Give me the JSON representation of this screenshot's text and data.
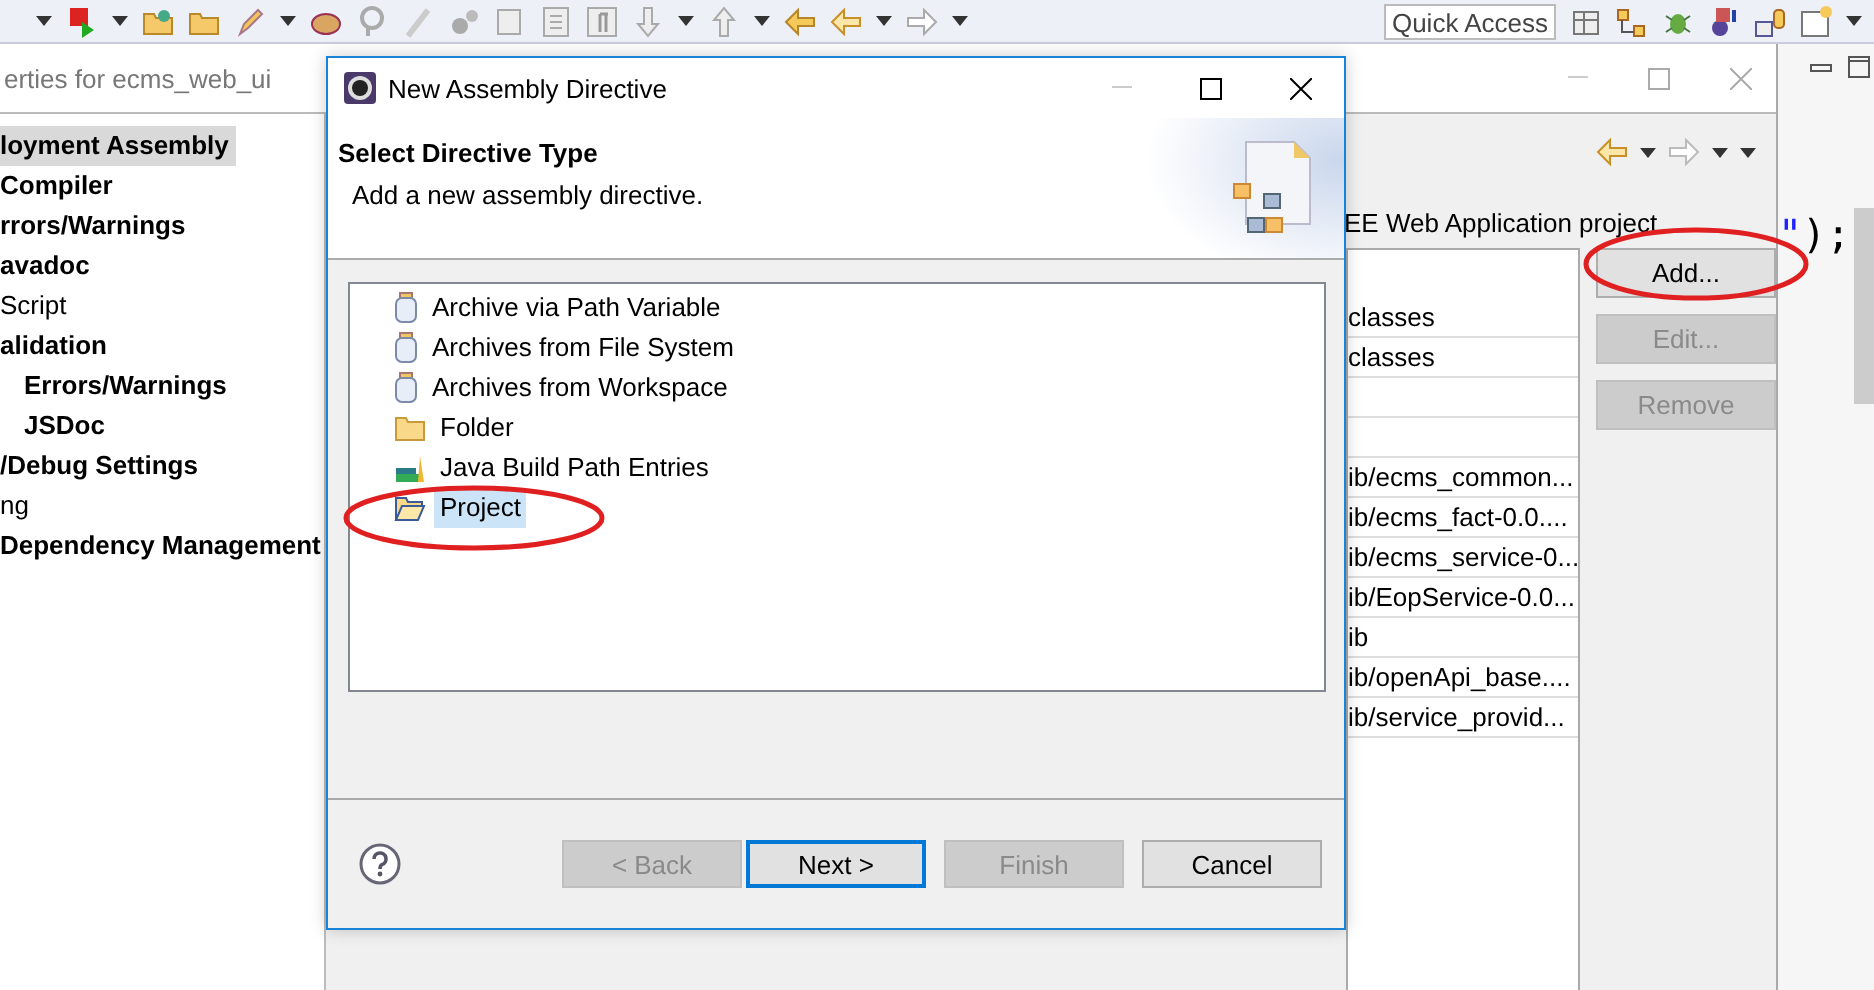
{
  "toolbar": {
    "quick_access": "Quick Access"
  },
  "properties_window": {
    "title": "erties for ecms_web_ui",
    "tree": [
      {
        "label": "loyment Assembly",
        "emphasized": true,
        "selected": true
      },
      {
        "label": "Compiler",
        "emphasized": true,
        "selected": false
      },
      {
        "label": "rrors/Warnings",
        "emphasized": true,
        "selected": false
      },
      {
        "label": "avadoc",
        "emphasized": true,
        "selected": false
      },
      {
        "label": "Script",
        "emphasized": false,
        "selected": false
      },
      {
        "label": "alidation",
        "emphasized": true,
        "selected": false,
        "children": [
          {
            "label": "Errors/Warnings",
            "emphasized": true,
            "selected": false
          },
          {
            "label": "JSDoc",
            "emphasized": true,
            "selected": false
          }
        ]
      },
      {
        "label": "/Debug Settings",
        "emphasized": true,
        "selected": false
      },
      {
        "label": "ng",
        "emphasized": false,
        "selected": false
      },
      {
        "label": "Dependency Management",
        "emphasized": true,
        "selected": false
      }
    ],
    "description": "EE Web Application project",
    "rows": [
      {
        "kind": "entry",
        "text": "classes"
      },
      {
        "kind": "entry",
        "text": "classes"
      },
      {
        "kind": "blank"
      },
      {
        "kind": "blank"
      },
      {
        "kind": "entry",
        "text": "ib/ecms_common..."
      },
      {
        "kind": "entry",
        "text": "ib/ecms_fact-0.0...."
      },
      {
        "kind": "entry",
        "text": "ib/ecms_service-0..."
      },
      {
        "kind": "entry",
        "text": "ib/EopService-0.0..."
      },
      {
        "kind": "entry",
        "text": "ib"
      },
      {
        "kind": "entry",
        "text": "ib/openApi_base...."
      },
      {
        "kind": "entry",
        "text": "ib/service_provid..."
      }
    ],
    "buttons": [
      {
        "label": "Add...",
        "disabled": false
      },
      {
        "label": "Edit...",
        "disabled": true
      },
      {
        "label": "Remove",
        "disabled": true
      }
    ]
  },
  "editor_fragment": [
    {
      "kind": "string",
      "text": "\""
    },
    {
      "kind": "code",
      "text": ");"
    }
  ],
  "dialog": {
    "title": "New Assembly Directive",
    "heading": "Select Directive Type",
    "description": "Add a new assembly directive.",
    "items": [
      {
        "kind": "archive",
        "label": "Archive via Path Variable",
        "selected": false
      },
      {
        "kind": "archive",
        "label": "Archives from File System",
        "selected": false
      },
      {
        "kind": "archive",
        "label": "Archives from Workspace",
        "selected": false
      },
      {
        "kind": "folder",
        "label": "Folder",
        "selected": false
      },
      {
        "kind": "library",
        "label": "Java Build Path Entries",
        "selected": false
      },
      {
        "kind": "project",
        "label": "Project",
        "selected": true
      }
    ],
    "buttons": [
      {
        "label": "< Back",
        "disabled": true,
        "default": false
      },
      {
        "label": "Next >",
        "disabled": false,
        "default": true
      },
      {
        "label": "Finish",
        "disabled": true,
        "default": false
      },
      {
        "label": "Cancel",
        "disabled": false,
        "default": false
      }
    ]
  }
}
